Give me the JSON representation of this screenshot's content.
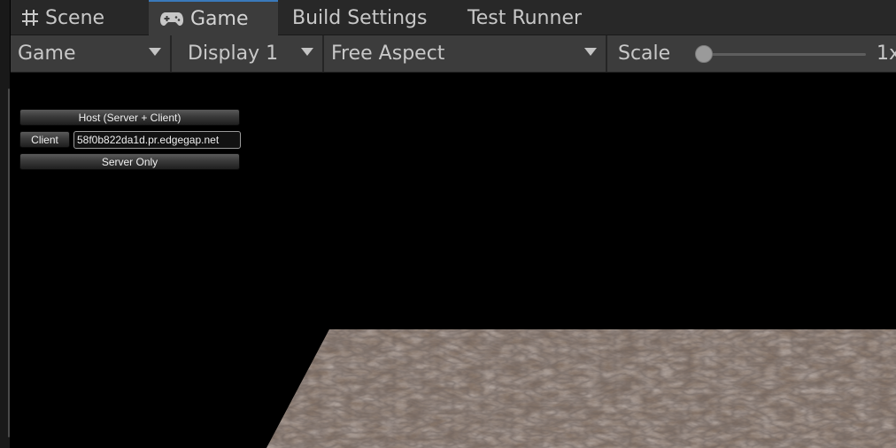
{
  "tabs": [
    {
      "label": "Scene",
      "icon": "grid-icon"
    },
    {
      "label": "Game",
      "icon": "gamepad-icon",
      "active": true
    },
    {
      "label": "Build Settings"
    },
    {
      "label": "Test Runner"
    }
  ],
  "toolbar": {
    "view_dropdown": "Game",
    "display_dropdown": "Display 1",
    "aspect_dropdown": "Free Aspect",
    "scale_label": "Scale",
    "scale_value": "1x",
    "scale_slider_fraction": 0.0
  },
  "network_hud": {
    "host_button": "Host (Server + Client)",
    "client_button": "Client",
    "address_value": "58f0b822da1d.pr.edgegap.net",
    "server_button": "Server Only"
  },
  "colors": {
    "active_tab_accent": "#3a79bb",
    "floor_base": "#7a6a60"
  }
}
